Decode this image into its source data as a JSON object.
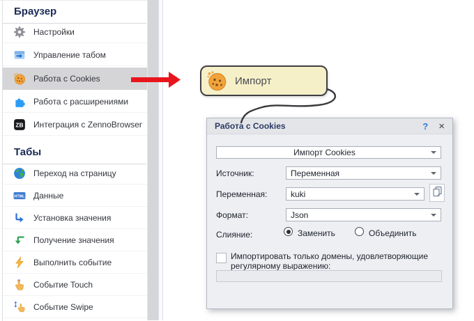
{
  "sidebar": {
    "sections": [
      {
        "title": "Браузер",
        "items": [
          {
            "label": "Настройки",
            "icon": "gear-icon"
          },
          {
            "label": "Управление табом",
            "icon": "tab-icon"
          },
          {
            "label": "Работа с Cookies",
            "icon": "cookie-icon",
            "selected": true
          },
          {
            "label": "Работа с расширениями",
            "icon": "puzzle-icon"
          },
          {
            "label": "Интеграция с ZennoBrowser",
            "icon": "zb-icon"
          }
        ]
      },
      {
        "title": "Табы",
        "items": [
          {
            "label": "Переход на страницу",
            "icon": "globe-icon"
          },
          {
            "label": "Данные",
            "icon": "html-icon"
          },
          {
            "label": "Установка значения",
            "icon": "set-value-icon"
          },
          {
            "label": "Получение значения",
            "icon": "get-value-icon"
          },
          {
            "label": "Выполнить событие",
            "icon": "lightning-icon"
          },
          {
            "label": "Событие Touch",
            "icon": "touch-icon"
          },
          {
            "label": "Событие Swipe",
            "icon": "swipe-icon"
          }
        ]
      }
    ],
    "icon_texts": {
      "zb": "ZB",
      "html": "HTML"
    }
  },
  "canvas": {
    "node": {
      "label": "Импорт",
      "icon": "cookie-icon"
    }
  },
  "dialog": {
    "title": "Работа с Cookies",
    "help_label": "?",
    "close_label": "×",
    "action_select": {
      "value": "Импорт Cookies"
    },
    "fields": {
      "source": {
        "label": "Источник:",
        "value": "Переменная"
      },
      "variable": {
        "label": "Переменная:",
        "value": "kuki"
      },
      "format": {
        "label": "Формат:",
        "value": "Json"
      },
      "merge": {
        "label": "Слияние:",
        "options": [
          {
            "label": "Заменить",
            "selected": true
          },
          {
            "label": "Объединить",
            "selected": false
          }
        ]
      }
    },
    "regex_checkbox": {
      "label": "Импортировать только домены, удовлетворяющие регулярному выражению:",
      "checked": false
    },
    "regex_input": {
      "value": ""
    }
  },
  "colors": {
    "arrow_red": "#e9151d",
    "node_bg": "#f5f0c8",
    "selection_bg": "#d5d5d7",
    "header_navy": "#1b2b55",
    "accent_blue": "#2e7cd6"
  }
}
